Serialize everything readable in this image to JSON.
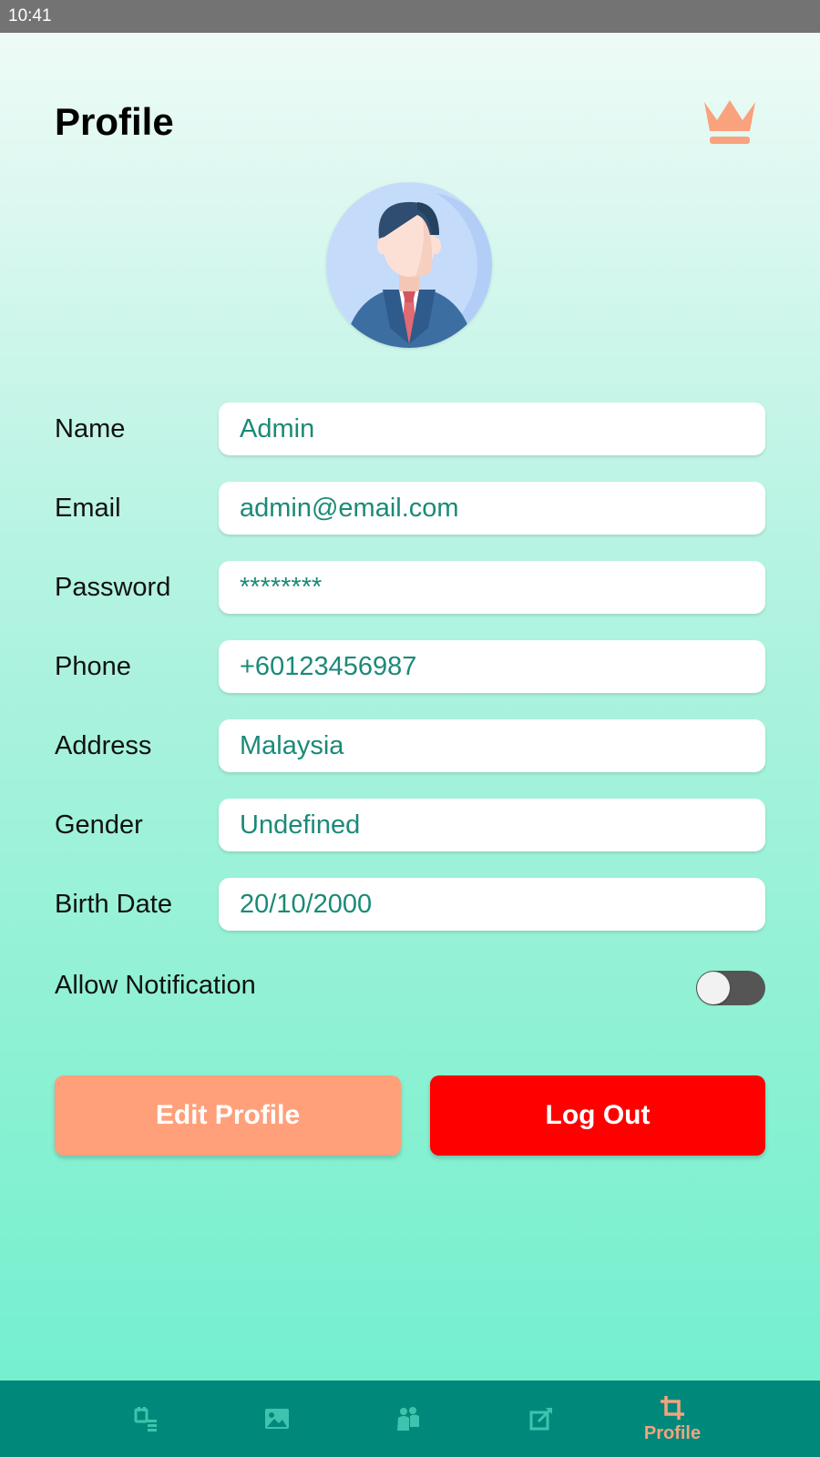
{
  "status_bar": {
    "time": "10:41"
  },
  "header": {
    "title": "Profile",
    "premium_icon": "crown-icon"
  },
  "avatar": {
    "icon": "businessman-avatar"
  },
  "form": {
    "fields": [
      {
        "label": "Name",
        "value": "Admin"
      },
      {
        "label": "Email",
        "value": "admin@email.com"
      },
      {
        "label": "Password",
        "value": "********"
      },
      {
        "label": "Phone",
        "value": "+60123456987"
      },
      {
        "label": "Address",
        "value": "Malaysia"
      },
      {
        "label": "Gender",
        "value": "Undefined"
      },
      {
        "label": "Birth Date",
        "value": "20/10/2000"
      }
    ]
  },
  "notification": {
    "label": "Allow Notification",
    "enabled": false
  },
  "actions": {
    "edit_label": "Edit Profile",
    "logout_label": "Log Out"
  },
  "bottom_nav": {
    "items": [
      {
        "icon": "schedule-list-icon",
        "label": ""
      },
      {
        "icon": "image-icon",
        "label": ""
      },
      {
        "icon": "people-icon",
        "label": ""
      },
      {
        "icon": "edit-icon",
        "label": ""
      },
      {
        "icon": "crop-icon",
        "label": "Profile",
        "active": true
      }
    ]
  },
  "colors": {
    "accent": "#ffa07a",
    "danger": "#ff0000",
    "field_text": "#1b8a77",
    "nav_background": "#00897b",
    "nav_active": "#f2a37f"
  }
}
